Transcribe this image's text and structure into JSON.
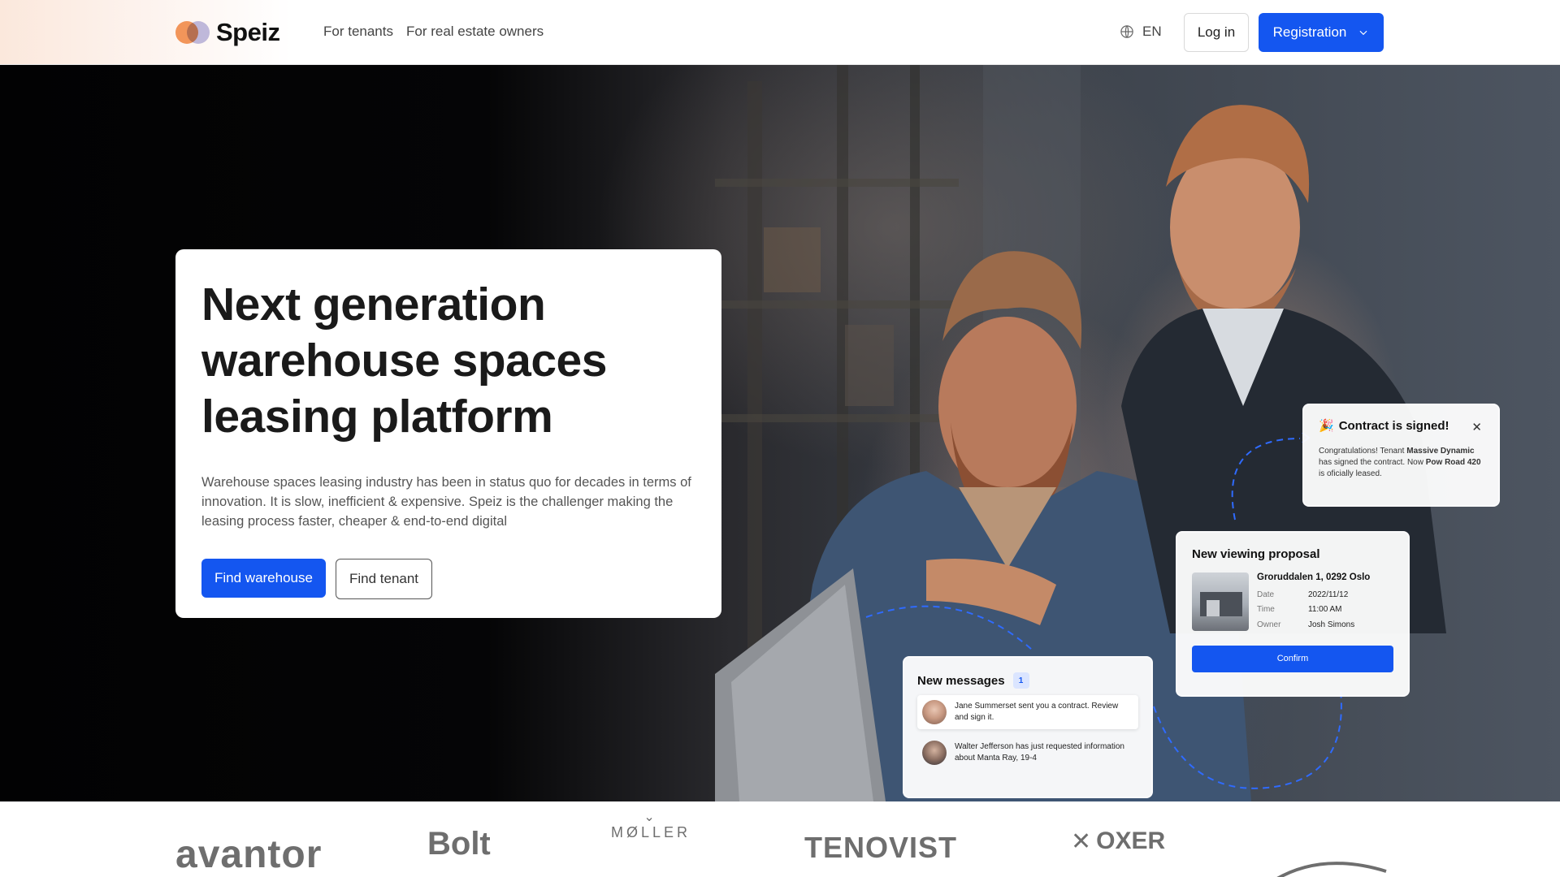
{
  "header": {
    "brand": "Speiz",
    "nav": [
      "For tenants",
      "For real estate owners"
    ],
    "language": "EN",
    "login_label": "Log in",
    "registration_label": "Registration"
  },
  "hero": {
    "title": "Next generation warehouse spaces leasing platform",
    "description": "Warehouse spaces leasing industry has been in status quo for decades in terms of innovation. It is slow, inefficient & expensive. Speiz is the challenger making the leasing process faster, cheaper & end-to-end digital",
    "primary_cta": "Find warehouse",
    "secondary_cta": "Find tenant"
  },
  "contract_card": {
    "emoji": "🎉",
    "title": "Contract is signed!",
    "text_prefix": "Congratulations! Tenant ",
    "tenant": "Massive Dynamic",
    "text_middle": " has signed the contract. Now ",
    "property": "Pow Road 420",
    "text_suffix": " is oficially leased."
  },
  "viewing_card": {
    "title": "New viewing proposal",
    "address": "Groruddalen 1, 0292 Oslo",
    "rows": [
      {
        "key": "Date",
        "value": "2022/11/12"
      },
      {
        "key": "Time",
        "value": "11:00 AM"
      },
      {
        "key": "Owner",
        "value": "Josh Simons"
      }
    ],
    "confirm_label": "Confirm"
  },
  "messages_card": {
    "title": "New messages",
    "count": "1",
    "items": [
      {
        "text": "Jane Summerset sent you a contract. Review and sign it."
      },
      {
        "text": "Walter Jefferson has just requested information about Manta Ray, 19-4"
      }
    ]
  },
  "partner_logos": [
    "avantor",
    "Bolt",
    "MØLLER",
    "TENOVIST",
    "OXER",
    ""
  ],
  "colors": {
    "accent": "#1456f0",
    "brand_orange": "#f2955a",
    "brand_lilac": "#b9b6e0"
  }
}
